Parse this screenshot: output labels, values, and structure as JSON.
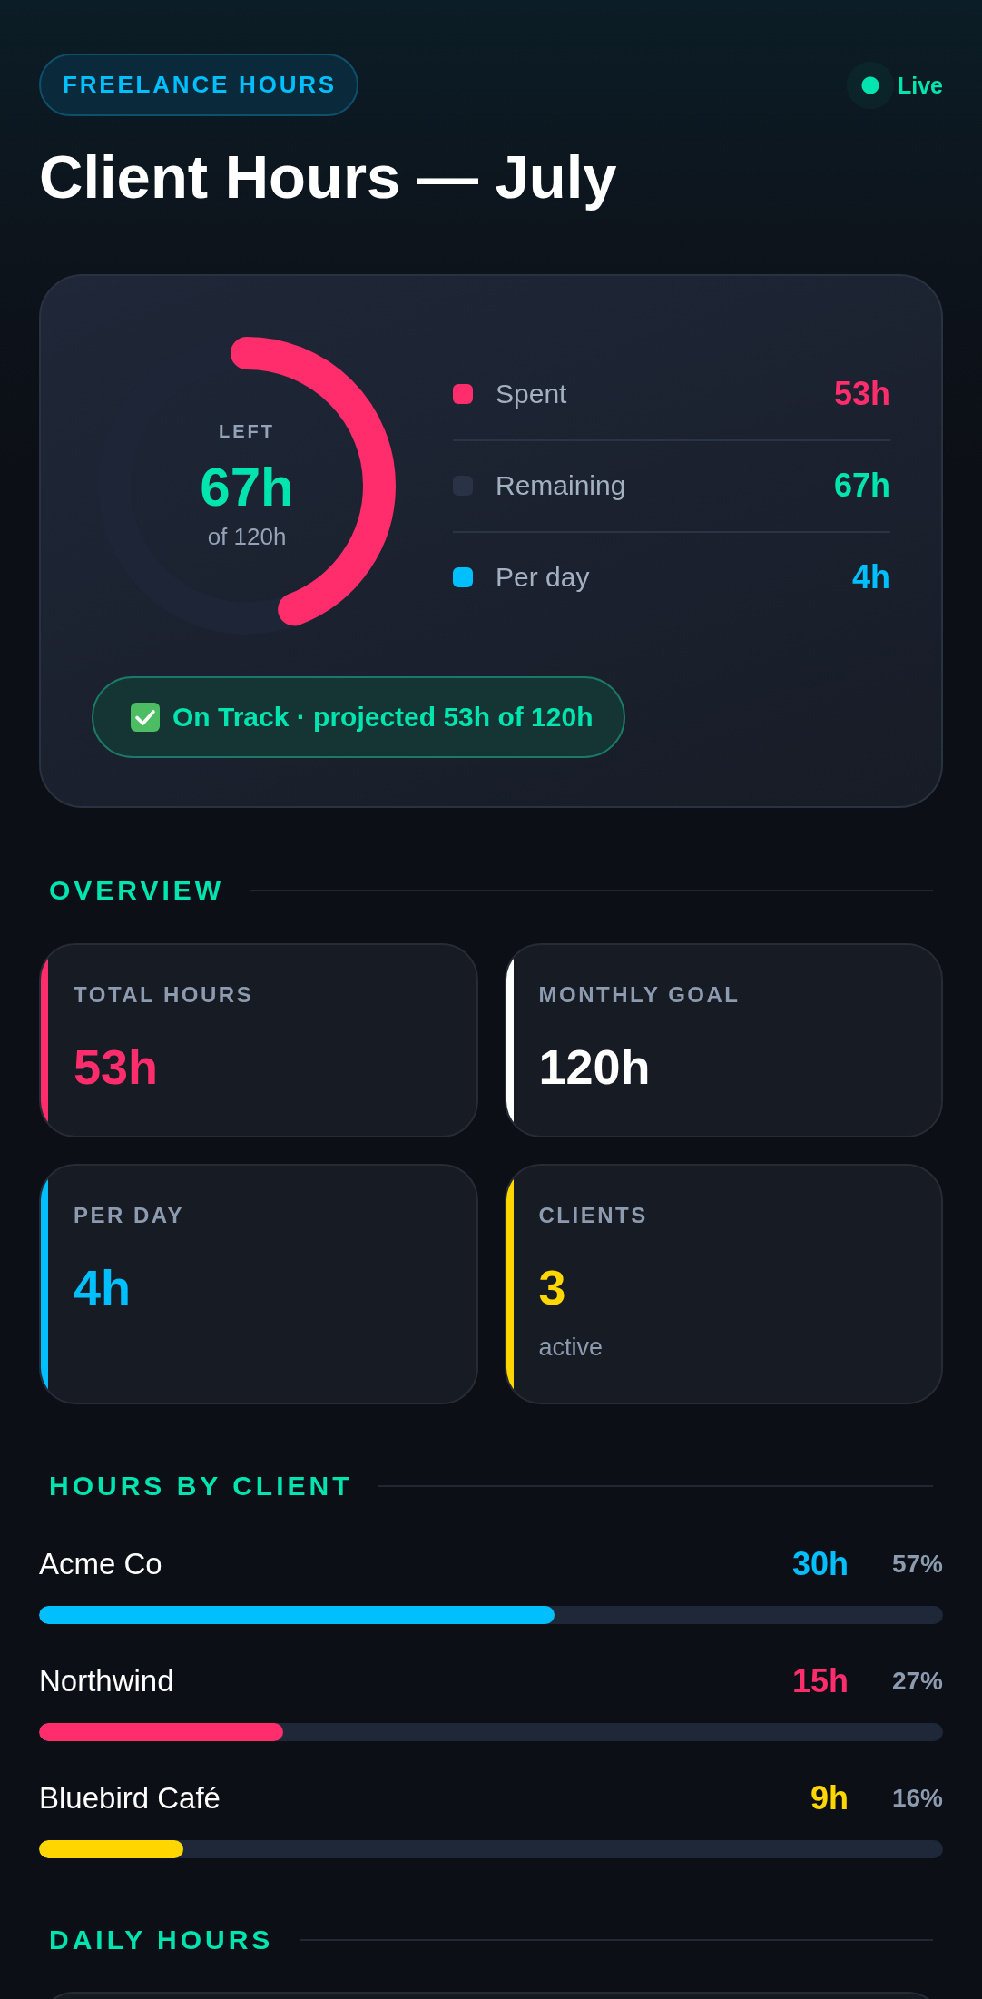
{
  "header": {
    "tag": "FREELANCE HOURS",
    "status": {
      "label": "Live",
      "on": true
    },
    "title": "Client Hours — July"
  },
  "summary": {
    "ring": {
      "caption": "LEFT",
      "value": "67h",
      "total": "of 120h",
      "level": 0.4417
    },
    "legend": [
      {
        "kind": "spent",
        "label": "Spent",
        "value": "53h",
        "color": "#ff2d6b"
      },
      {
        "kind": "remaining",
        "label": "Remaining",
        "value": "67h",
        "color": "#2a3346"
      },
      {
        "kind": "rate",
        "label": "Per day",
        "value": "4h",
        "color": "#00bfff"
      }
    ],
    "badge": {
      "text": "On Track · projected 53h of 120h"
    }
  },
  "overview": {
    "heading": "OVERVIEW",
    "cards": [
      {
        "label": "TOTAL HOURS",
        "value": "53h",
        "color": "#ff2d6b"
      },
      {
        "label": "MONTHLY GOAL",
        "value": "120h",
        "color": "#ffffff"
      },
      {
        "label": "PER DAY",
        "value": "4h",
        "color": "#00bfff"
      },
      {
        "label": "CLIENTS",
        "value": "3",
        "note": "active",
        "color": "#ffd600"
      }
    ]
  },
  "hours_by_client": {
    "heading": "HOURS BY CLIENT",
    "clients": [
      {
        "name": "Acme Co",
        "hours": "30h",
        "share": "57%",
        "level": 0.57,
        "color": "#00bfff"
      },
      {
        "name": "Northwind",
        "hours": "15h",
        "share": "27%",
        "level": 0.27,
        "color": "#ff2d6b"
      },
      {
        "name": "Bluebird Café",
        "hours": "9h",
        "share": "16%",
        "level": 0.16,
        "color": "#ffd600"
      }
    ]
  },
  "daily_hours": {
    "heading": "DAILY HOURS"
  }
}
